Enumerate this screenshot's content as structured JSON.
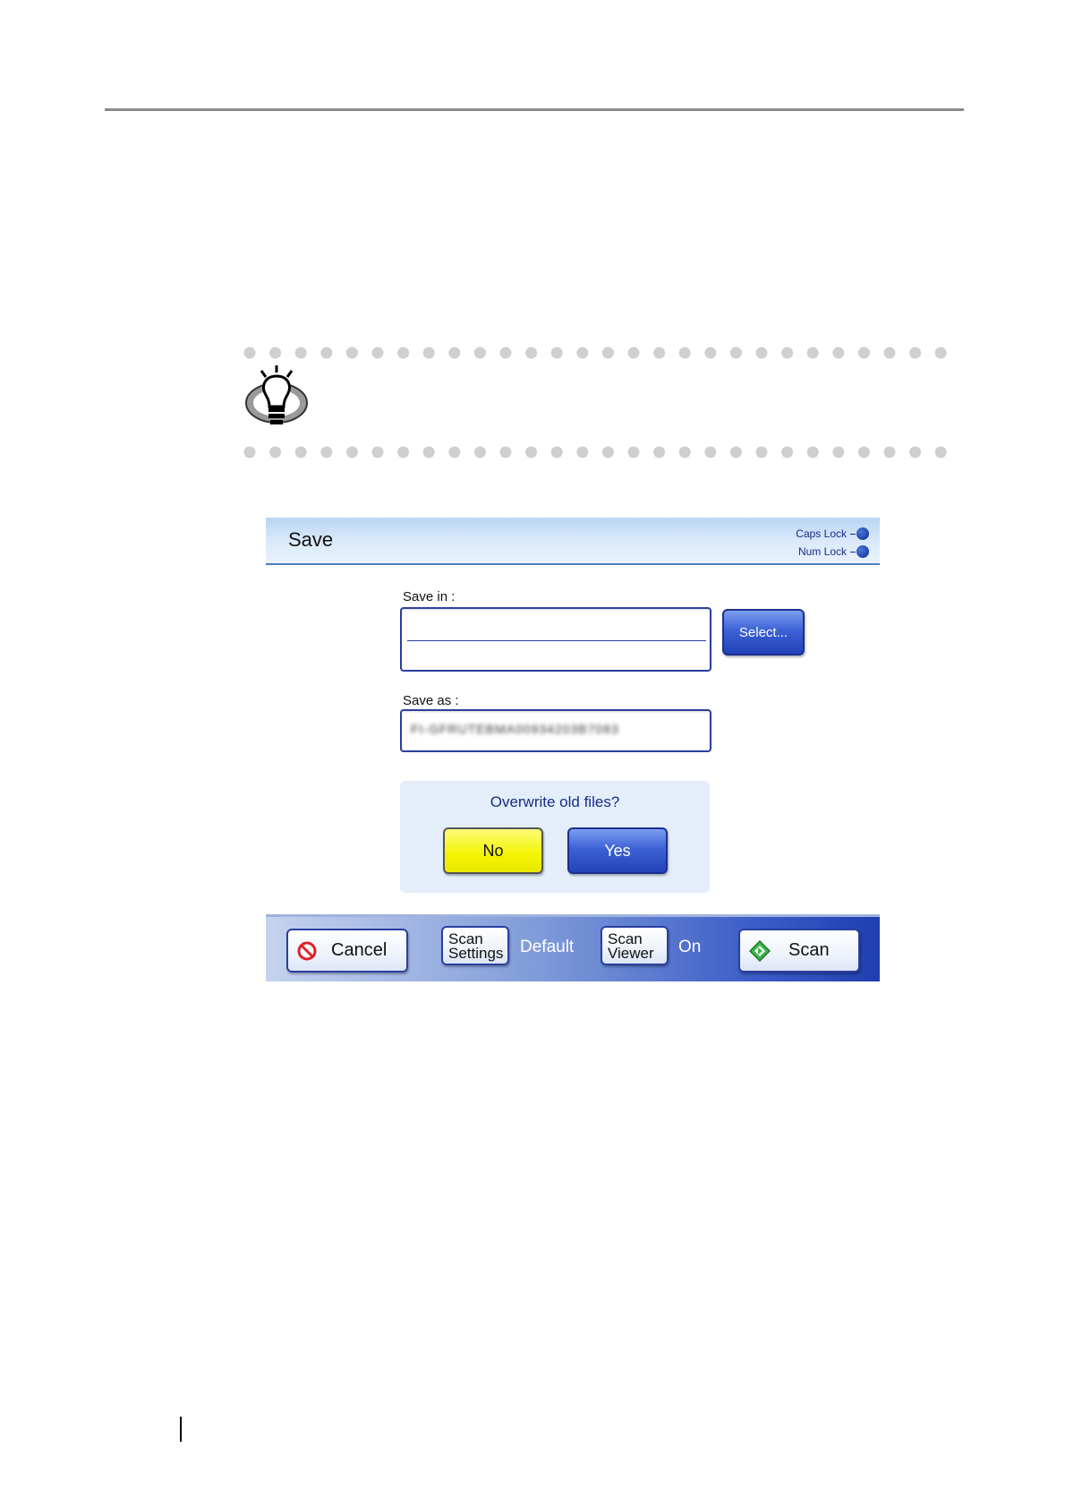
{
  "dialog": {
    "title": "Save",
    "indicators": {
      "caps_lock": "Caps Lock",
      "num_lock": "Num Lock"
    }
  },
  "save_in": {
    "label": "Save in :",
    "value_line1": "",
    "value_line2": "",
    "select_button": "Select..."
  },
  "save_as": {
    "label": "Save as :",
    "value": "FI-GFRUTEBMA00934203B7083"
  },
  "overwrite": {
    "question": "Overwrite old files?",
    "no_label": "No",
    "yes_label": "Yes"
  },
  "bottom_bar": {
    "cancel_label": "Cancel",
    "scan_settings_line1": "Scan",
    "scan_settings_line2": "Settings",
    "scan_settings_status": "Default",
    "scan_viewer_line1": "Scan",
    "scan_viewer_line2": "Viewer",
    "scan_viewer_status": "On",
    "scan_label": "Scan"
  },
  "colors": {
    "accent_blue": "#2342b8",
    "no_button_yellow": "#f4f400",
    "title_text": "#1a2b8a"
  },
  "icons": {
    "hint": "lightbulb-hint-icon",
    "cancel": "prohibited-icon",
    "scan": "green-diamond-start-icon"
  }
}
